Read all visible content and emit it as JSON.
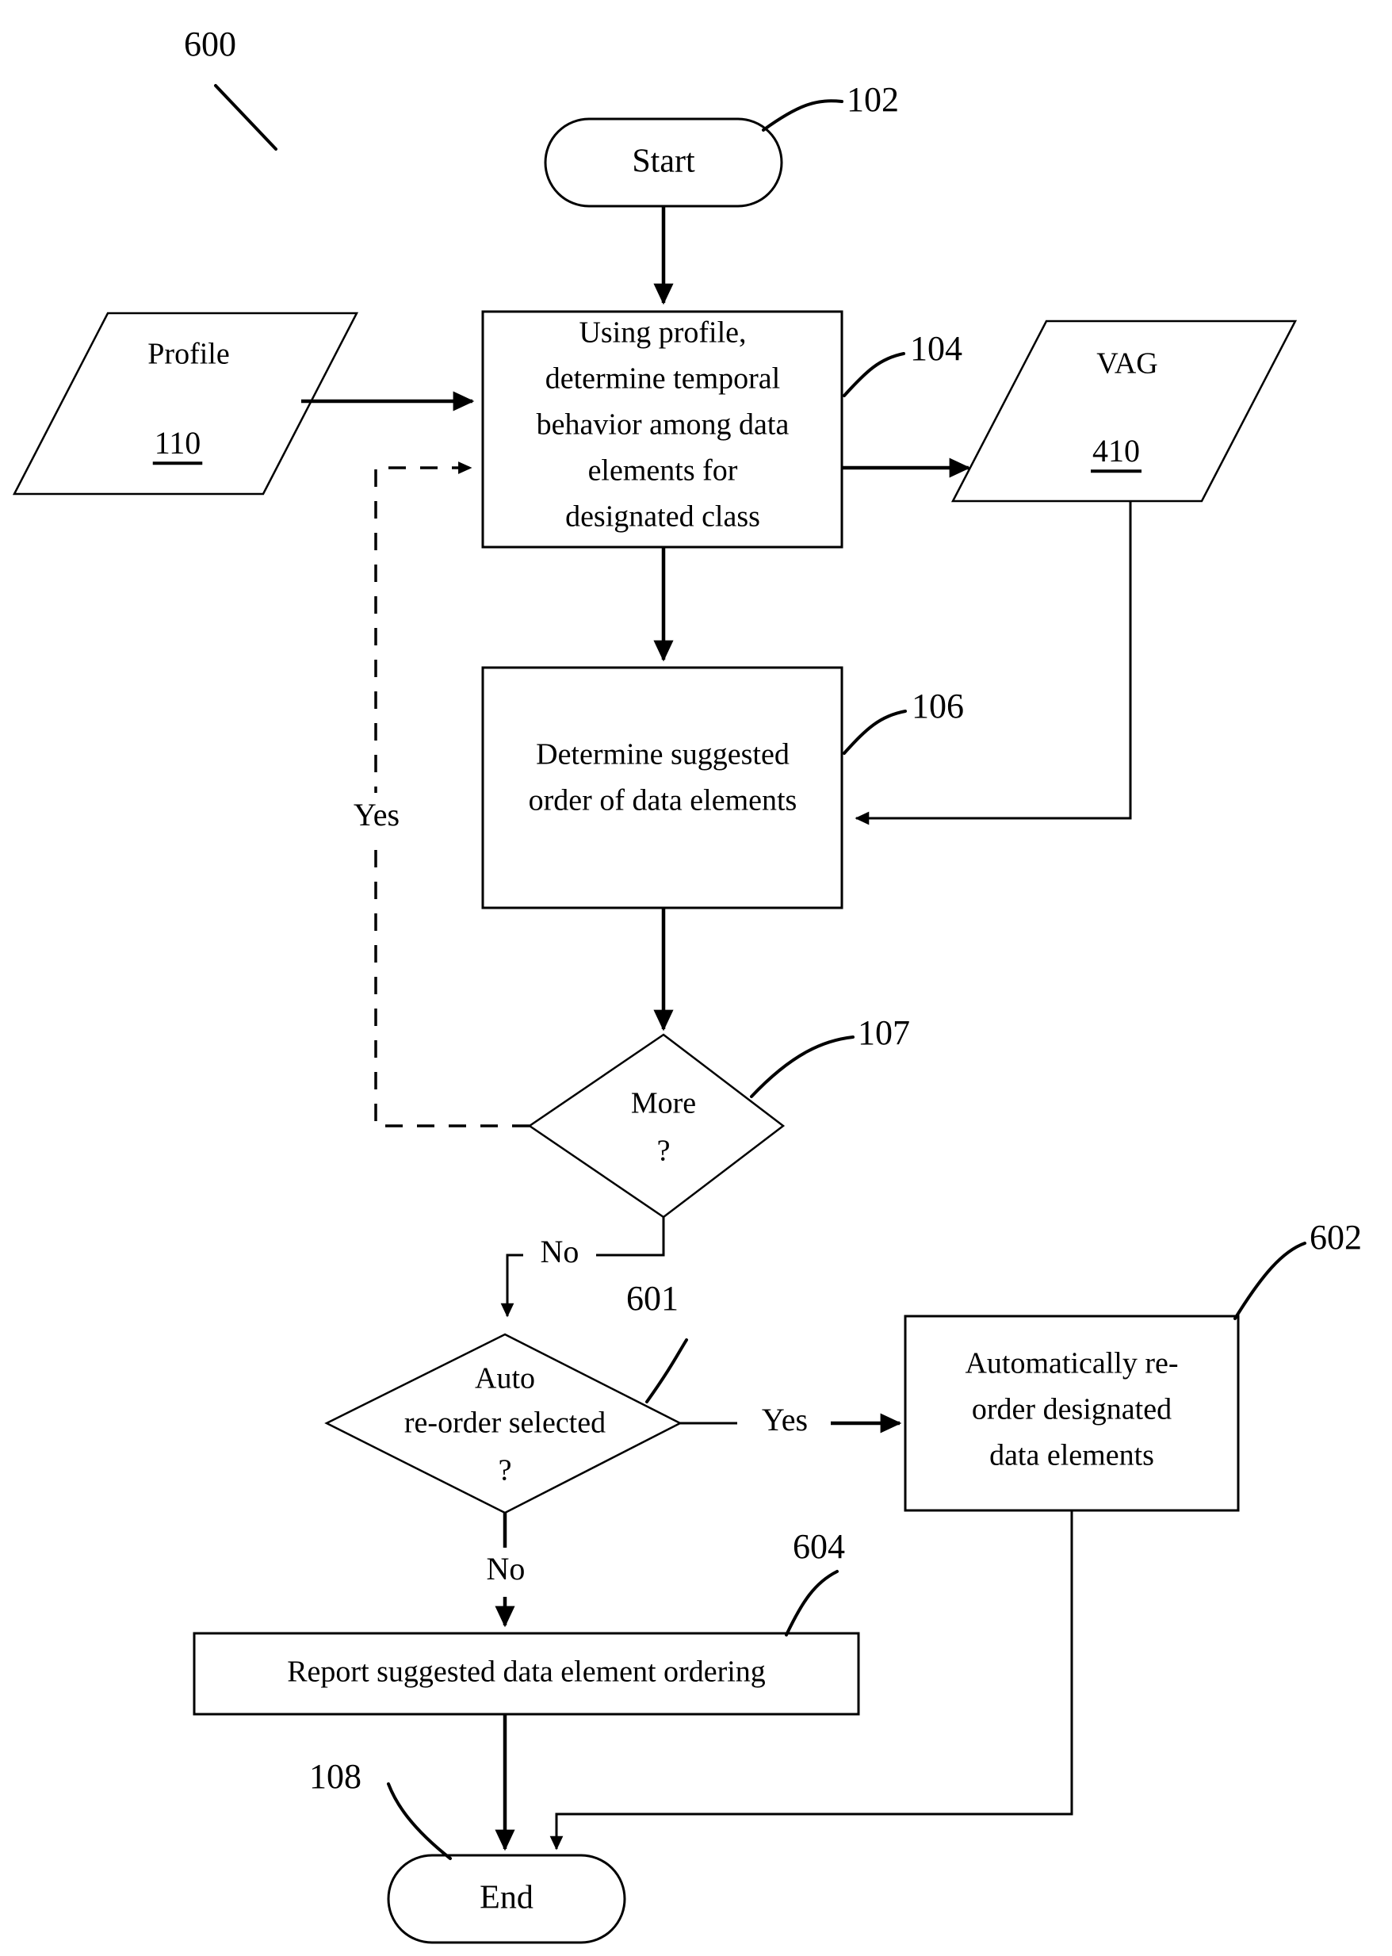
{
  "figure": {
    "figure_number": "600"
  },
  "nodes": {
    "start": {
      "label": "Start",
      "ref": "102",
      "shape": "terminator"
    },
    "profile": {
      "label": "Profile",
      "id_number": "110",
      "shape": "data-parallelogram"
    },
    "determine_temporal": {
      "ref": "104",
      "shape": "process",
      "lines": [
        "Using profile,",
        "determine temporal",
        "behavior among  data",
        "elements for",
        "designated class"
      ]
    },
    "vag": {
      "label": "VAG",
      "id_number": "410",
      "shape": "data-parallelogram"
    },
    "determine_order": {
      "ref": "106",
      "shape": "process",
      "lines": [
        "Determine suggested",
        "order of data elements"
      ]
    },
    "more_decision": {
      "ref": "107",
      "shape": "decision",
      "lines": [
        "More",
        "?"
      ]
    },
    "auto_decision": {
      "ref": "601",
      "shape": "decision",
      "lines": [
        "Auto",
        "re-order selected",
        "?"
      ]
    },
    "auto_reorder": {
      "ref": "602",
      "shape": "process",
      "lines": [
        "Automatically re-",
        "order designated",
        "data elements"
      ]
    },
    "report": {
      "ref": "604",
      "shape": "process",
      "lines": [
        "Report suggested data element ordering"
      ]
    },
    "end": {
      "label": "End",
      "ref": "108",
      "shape": "terminator"
    }
  },
  "edge_labels": {
    "more_yes": "Yes",
    "more_no": "No",
    "auto_yes": "Yes",
    "auto_no": "No"
  },
  "colors": {
    "stroke": "#000000",
    "fill": "#ffffff",
    "background": "#ffffff"
  }
}
